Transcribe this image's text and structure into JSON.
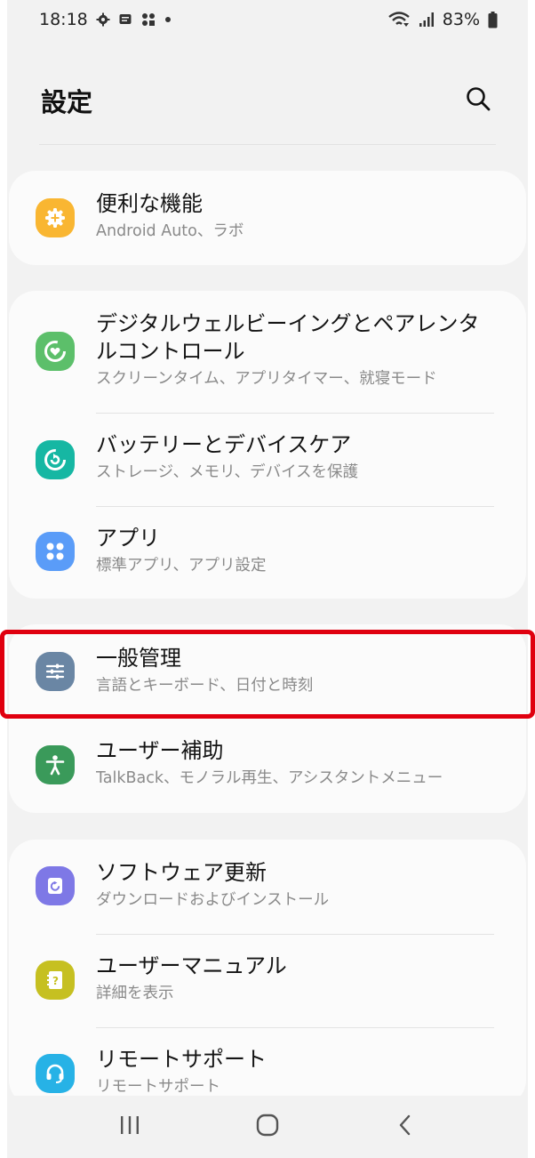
{
  "status_bar": {
    "time": "18:18",
    "battery": "83%"
  },
  "header": {
    "title": "設定"
  },
  "groups": [
    {
      "items": [
        {
          "title": "便利な機能",
          "subtitle": "Android Auto、ラボ",
          "icon": "gear-plus-icon",
          "color": "#f9b632"
        }
      ]
    },
    {
      "items": [
        {
          "title_line1": "デジタルウェルビーイングとペアレンタ",
          "title_line2": "ルコントロール",
          "subtitle": "スクリーンタイム、アプリタイマー、就寝モード",
          "icon": "wellbeing-heart-icon",
          "color": "#5cbf6a"
        },
        {
          "title": "バッテリーとデバイスケア",
          "subtitle": "ストレージ、メモリ、デバイスを保護",
          "icon": "device-care-icon",
          "color": "#16b7a3"
        },
        {
          "title": "アプリ",
          "subtitle": "標準アプリ、アプリ設定",
          "icon": "apps-grid-icon",
          "color": "#5a9cf8"
        }
      ]
    },
    {
      "items": [
        {
          "title": "一般管理",
          "subtitle": "言語とキーボード、日付と時刻",
          "icon": "sliders-icon",
          "color": "#6a86a4"
        },
        {
          "title": "ユーザー補助",
          "subtitle": "TalkBack、モノラル再生、アシスタントメニュー",
          "icon": "accessibility-person-icon",
          "color": "#3a9a5a"
        }
      ]
    },
    {
      "items": [
        {
          "title": "ソフトウェア更新",
          "subtitle": "ダウンロードおよびインストール",
          "icon": "software-update-icon",
          "color": "#7e78e6"
        },
        {
          "title": "ユーザーマニュアル",
          "subtitle": "詳細を表示",
          "icon": "manual-book-icon",
          "color": "#c6c021"
        },
        {
          "title": "リモートサポート",
          "subtitle": "リモートサポート",
          "icon": "headset-icon",
          "color": "#27b2e6"
        }
      ]
    }
  ],
  "colors": {
    "highlight": "#e0000f",
    "background": "#f2f2f2",
    "card": "#fbfbfb"
  }
}
